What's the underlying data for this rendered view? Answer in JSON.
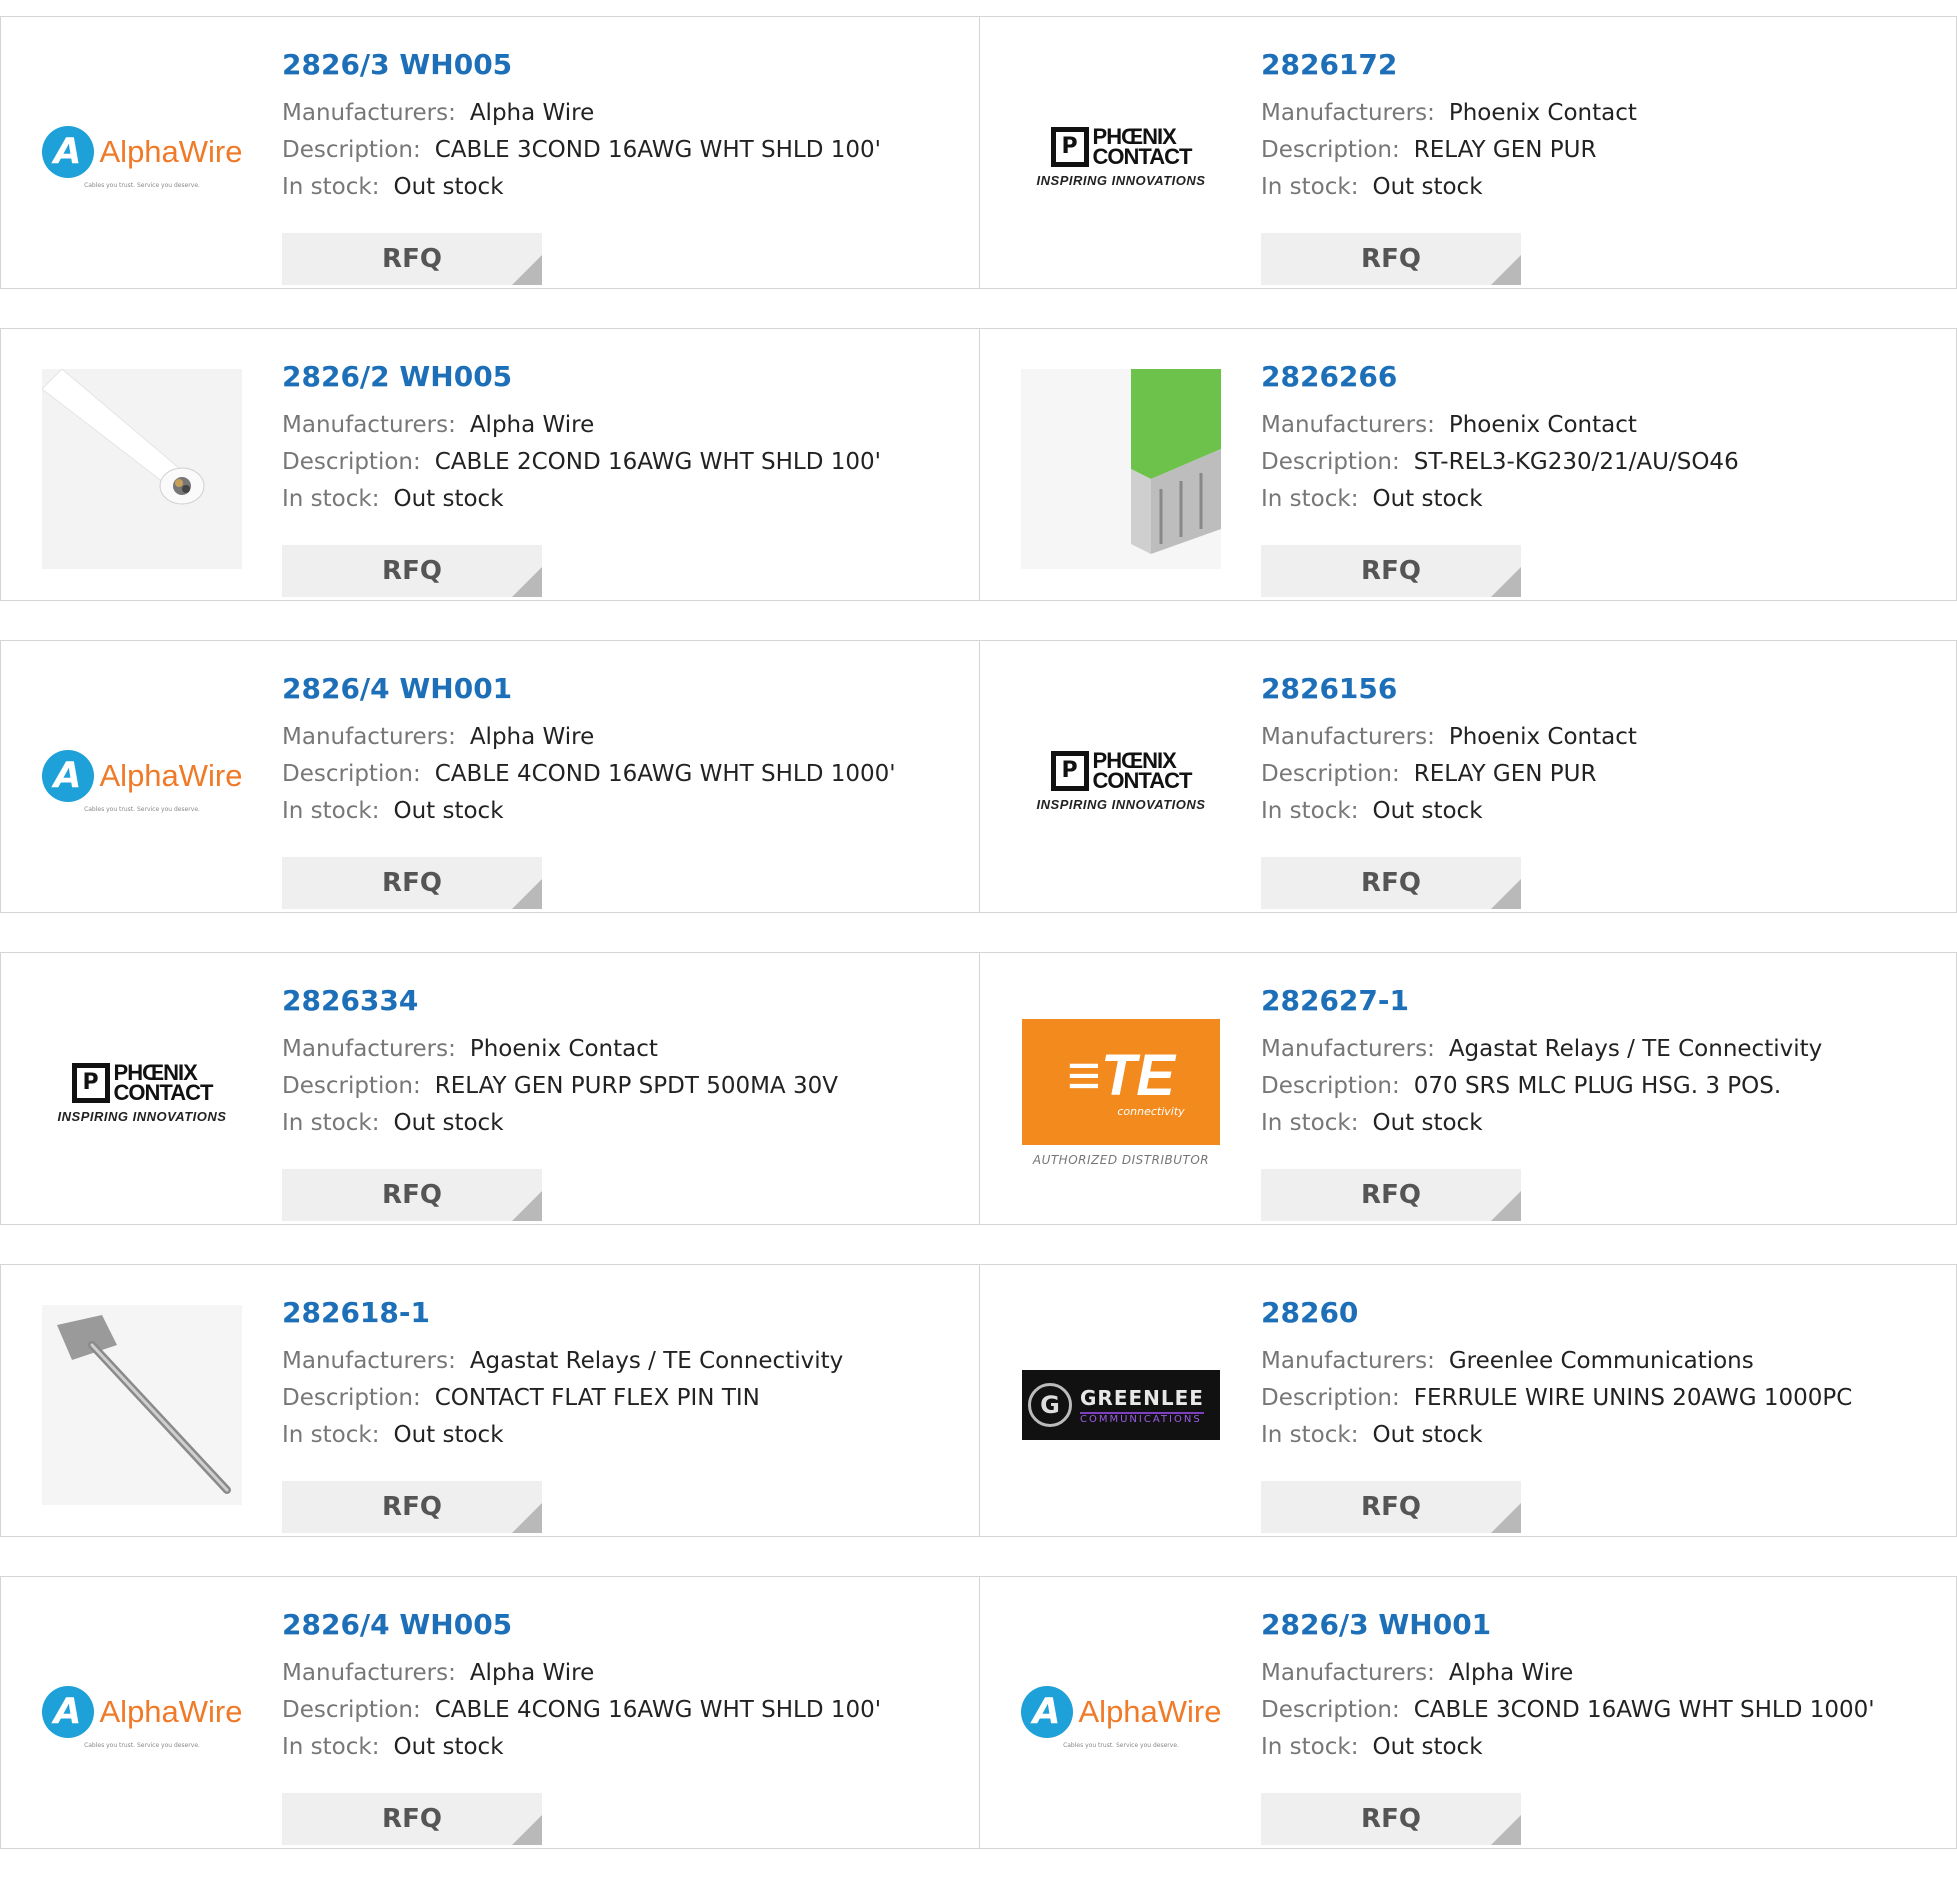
{
  "common": {
    "manufacturers_label": "Manufacturers:",
    "description_label": "Description:",
    "stock_label": "In stock:",
    "rfq_label": "RFQ"
  },
  "colors": {
    "link": "#1d6fb8",
    "alphawire_orange": "#f07a27",
    "alphawire_blue": "#1ea0d8",
    "te_orange": "#f28a1d"
  },
  "logos": {
    "alphawire": {
      "name": "AlphaWire",
      "tagline": "Cables you trust. Service you deserve."
    },
    "phoenix": {
      "line1": "PHŒNIX",
      "line2": "CONTACT",
      "tagline": "INSPIRING INNOVATIONS"
    },
    "te": {
      "mark": "TE",
      "sub": "connectivity",
      "authorized": "AUTHORIZED DISTRIBUTOR"
    },
    "greenlee": {
      "name": "GREENLEE",
      "sub": "COMMUNICATIONS"
    }
  },
  "products": [
    {
      "part": "2826/3 WH005",
      "manufacturer": "Alpha Wire",
      "description": "CABLE 3COND 16AWG WHT SHLD 100'",
      "stock": "Out stock",
      "image": "alphawire-logo"
    },
    {
      "part": "2826172",
      "manufacturer": "Phoenix Contact",
      "description": "RELAY GEN PUR",
      "stock": "Out stock",
      "image": "phoenix-contact-logo"
    },
    {
      "part": "2826/2 WH005",
      "manufacturer": "Alpha Wire",
      "description": "CABLE 2COND 16AWG WHT SHLD 100'",
      "stock": "Out stock",
      "image": "white-cable-photo"
    },
    {
      "part": "2826266",
      "manufacturer": "Phoenix Contact",
      "description": "ST-REL3-KG230/21/AU/SO46",
      "stock": "Out stock",
      "image": "relay-module-photo"
    },
    {
      "part": "2826/4 WH001",
      "manufacturer": "Alpha Wire",
      "description": "CABLE 4COND 16AWG WHT SHLD 1000'",
      "stock": "Out stock",
      "image": "alphawire-logo"
    },
    {
      "part": "2826156",
      "manufacturer": "Phoenix Contact",
      "description": "RELAY GEN PUR",
      "stock": "Out stock",
      "image": "phoenix-contact-logo"
    },
    {
      "part": "2826334",
      "manufacturer": "Phoenix Contact",
      "description": "RELAY GEN PURP SPDT 500MA 30V",
      "stock": "Out stock",
      "image": "phoenix-contact-logo"
    },
    {
      "part": "282627-1",
      "manufacturer": "Agastat Relays / TE Connectivity",
      "description": "070 SRS MLC PLUG HSG. 3 POS.",
      "stock": "Out stock",
      "image": "te-connectivity-logo"
    },
    {
      "part": "282618-1",
      "manufacturer": "Agastat Relays / TE Connectivity",
      "description": "CONTACT FLAT FLEX PIN TIN",
      "stock": "Out stock",
      "image": "contact-pin-photo"
    },
    {
      "part": "28260",
      "manufacturer": "Greenlee Communications",
      "description": "FERRULE WIRE UNINS 20AWG 1000PC",
      "stock": "Out stock",
      "image": "greenlee-logo"
    },
    {
      "part": "2826/4 WH005",
      "manufacturer": "Alpha Wire",
      "description": "CABLE 4CONG 16AWG WHT SHLD 100'",
      "stock": "Out stock",
      "image": "alphawire-logo"
    },
    {
      "part": "2826/3 WH001",
      "manufacturer": "Alpha Wire",
      "description": "CABLE 3COND 16AWG WHT SHLD 1000'",
      "stock": "Out stock",
      "image": "alphawire-logo"
    }
  ]
}
